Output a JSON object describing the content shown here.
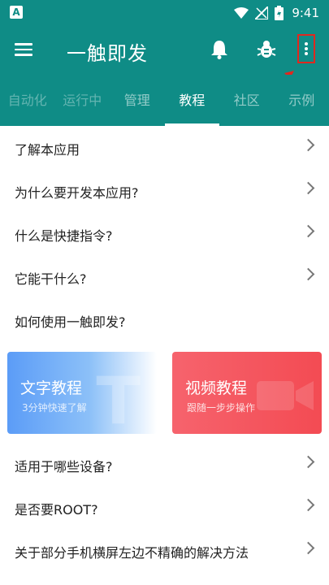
{
  "status": {
    "badge": "A",
    "time": "9:41"
  },
  "app": {
    "title": "一触即发"
  },
  "tabs": [
    {
      "label": "自动化"
    },
    {
      "label": "运行中"
    },
    {
      "label": "管理"
    },
    {
      "label": "教程"
    },
    {
      "label": "社区"
    },
    {
      "label": "示例"
    }
  ],
  "list_top": [
    {
      "label": "了解本应用"
    },
    {
      "label": "为什么要开发本应用?"
    },
    {
      "label": "什么是快捷指令?"
    },
    {
      "label": "它能干什么?"
    },
    {
      "label": "如何使用一触即发?"
    }
  ],
  "cards": {
    "text": {
      "title": "文字教程",
      "subtitle": "3分钟快速了解"
    },
    "video": {
      "title": "视频教程",
      "subtitle": "跟随一步步操作"
    }
  },
  "list_bottom": [
    {
      "label": "适用于哪些设备?"
    },
    {
      "label": "是否要ROOT?"
    },
    {
      "label": "关于部分手机横屏左边不精确的解决方法"
    }
  ],
  "colors": {
    "primary": "#0f8c86",
    "annotation": "#e0281f"
  }
}
